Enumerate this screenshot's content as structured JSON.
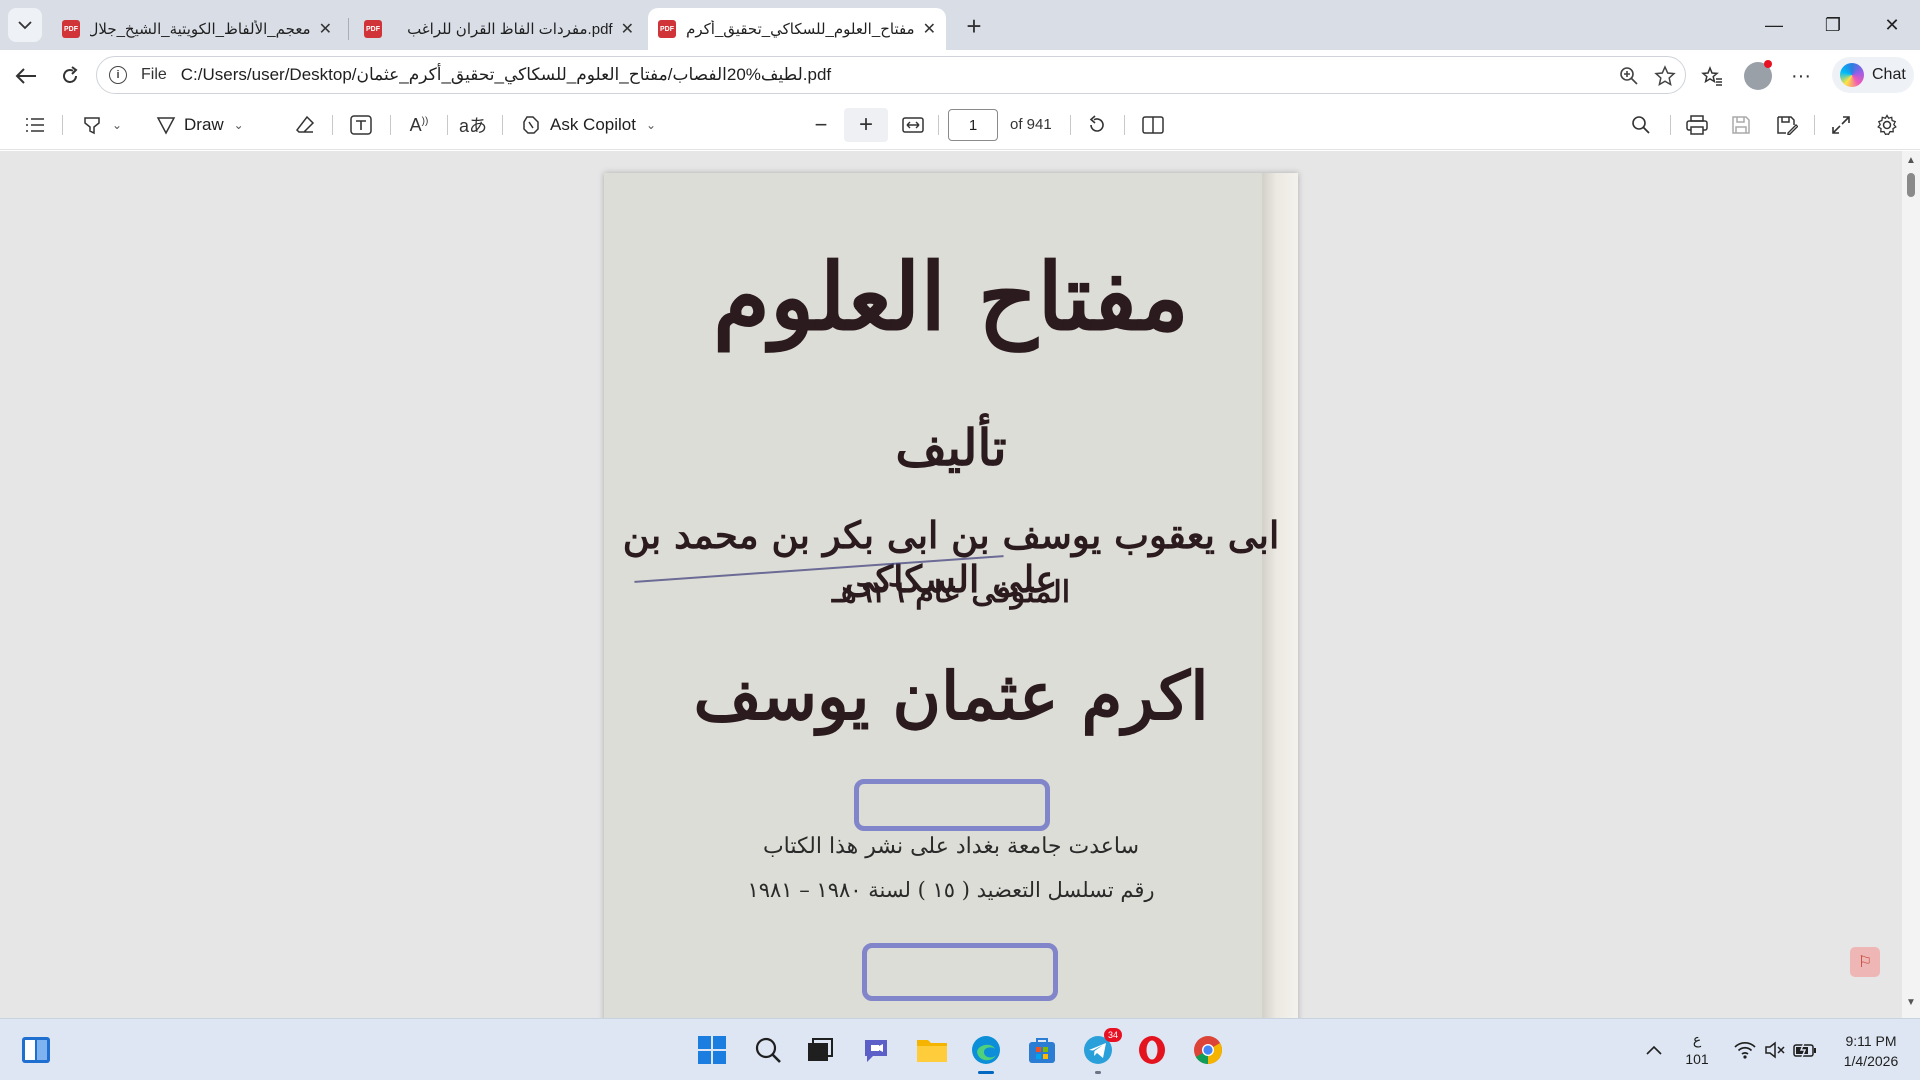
{
  "browser": {
    "tabs": [
      {
        "title": "معجم_الألفاظ_الكويتية_الشيخ_جلال_ال",
        "active": false
      },
      {
        "title": "pdf.مفردات الفاظ القران للراغب",
        "active": false
      },
      {
        "title": "مفتاح_العلوم_للسكاكي_تحقيق_أكرم_ع",
        "active": true
      }
    ],
    "tab_icon_label": "PDF",
    "new_tab_glyph": "+",
    "window_controls": {
      "minimize": "—",
      "restore": "❐",
      "close": "✕"
    },
    "address": {
      "protocol_label": "File",
      "url": "C:/Users/user/Desktop/لطيف%20الفصاب/مفتاح_العلوم_للسكاكي_تحقيق_أكرم_عثمان.pdf"
    },
    "chat_label": "Chat"
  },
  "pdf_toolbar": {
    "draw_label": "Draw",
    "copilot_label": "Ask Copilot",
    "page_current": "1",
    "page_total": "of 941"
  },
  "document_page": {
    "title": "مفتاح العلوم",
    "by_label": "تأليف",
    "author": "ابى يعقوب يوسف بن ابى بكر بن محمد بن على السكاكى",
    "death": "المتوفى عام ٦٢٦هـ",
    "editor": "اكرم عثمان يوسف",
    "note_line1": "ساعدت جامعة بغداد على نشر هذا الكتاب",
    "note_line2": "رقم تسلسل التعضيد ( ١٥ ) لسنة ١٩٨٠ – ١٩٨١"
  },
  "taskbar": {
    "telegram_badge": "34",
    "ime_top": "ع",
    "ime_bottom": "101",
    "time": "9:11 PM",
    "date": "1/4/2026"
  },
  "colors": {
    "tabstrip": "#d8dde6",
    "viewer_bg": "#e6e6e6",
    "page_paper": "#ddddd7",
    "ink": "#2b1b1f",
    "stamp": "#6a6fc6",
    "taskbar": "#dde6f2"
  }
}
